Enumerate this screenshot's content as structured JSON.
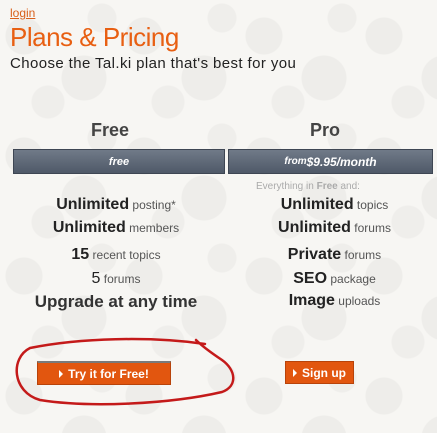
{
  "header": {
    "login_link": "login",
    "title": "Plans & Pricing",
    "subtitle": "Choose the Tal.ki plan that's best for you"
  },
  "plans": {
    "free": {
      "heading": "Free",
      "bar_label": "free",
      "features": [
        {
          "strong": "Unlimited",
          "small": " posting*"
        },
        {
          "strong": "Unlimited",
          "small": " members"
        },
        {
          "strong": "15",
          "small": " recent topics"
        },
        {
          "strong": "5",
          "small": " forums"
        },
        {
          "strong": "Upgrade at any time",
          "small": ""
        }
      ],
      "button_label": "Try it for Free!"
    },
    "pro": {
      "heading": "Pro",
      "bar_prefix": "from ",
      "bar_price": "$9.95/month",
      "note_prefix": "Everything in ",
      "note_bold": "Free",
      "note_suffix": " and:",
      "features": [
        {
          "strong": "Unlimited",
          "small": " topics"
        },
        {
          "strong": "Unlimited",
          "small": " forums"
        },
        {
          "strong": "Private",
          "small": " forums"
        },
        {
          "strong": "SEO",
          "small": " package"
        },
        {
          "strong": "Image",
          "small": " uploads"
        }
      ],
      "button_label": "Sign up"
    }
  },
  "colors": {
    "accent": "#e85f12",
    "bar": "#5b6473",
    "button": "#e2560f",
    "highlight_ring": "#c41a1a"
  }
}
